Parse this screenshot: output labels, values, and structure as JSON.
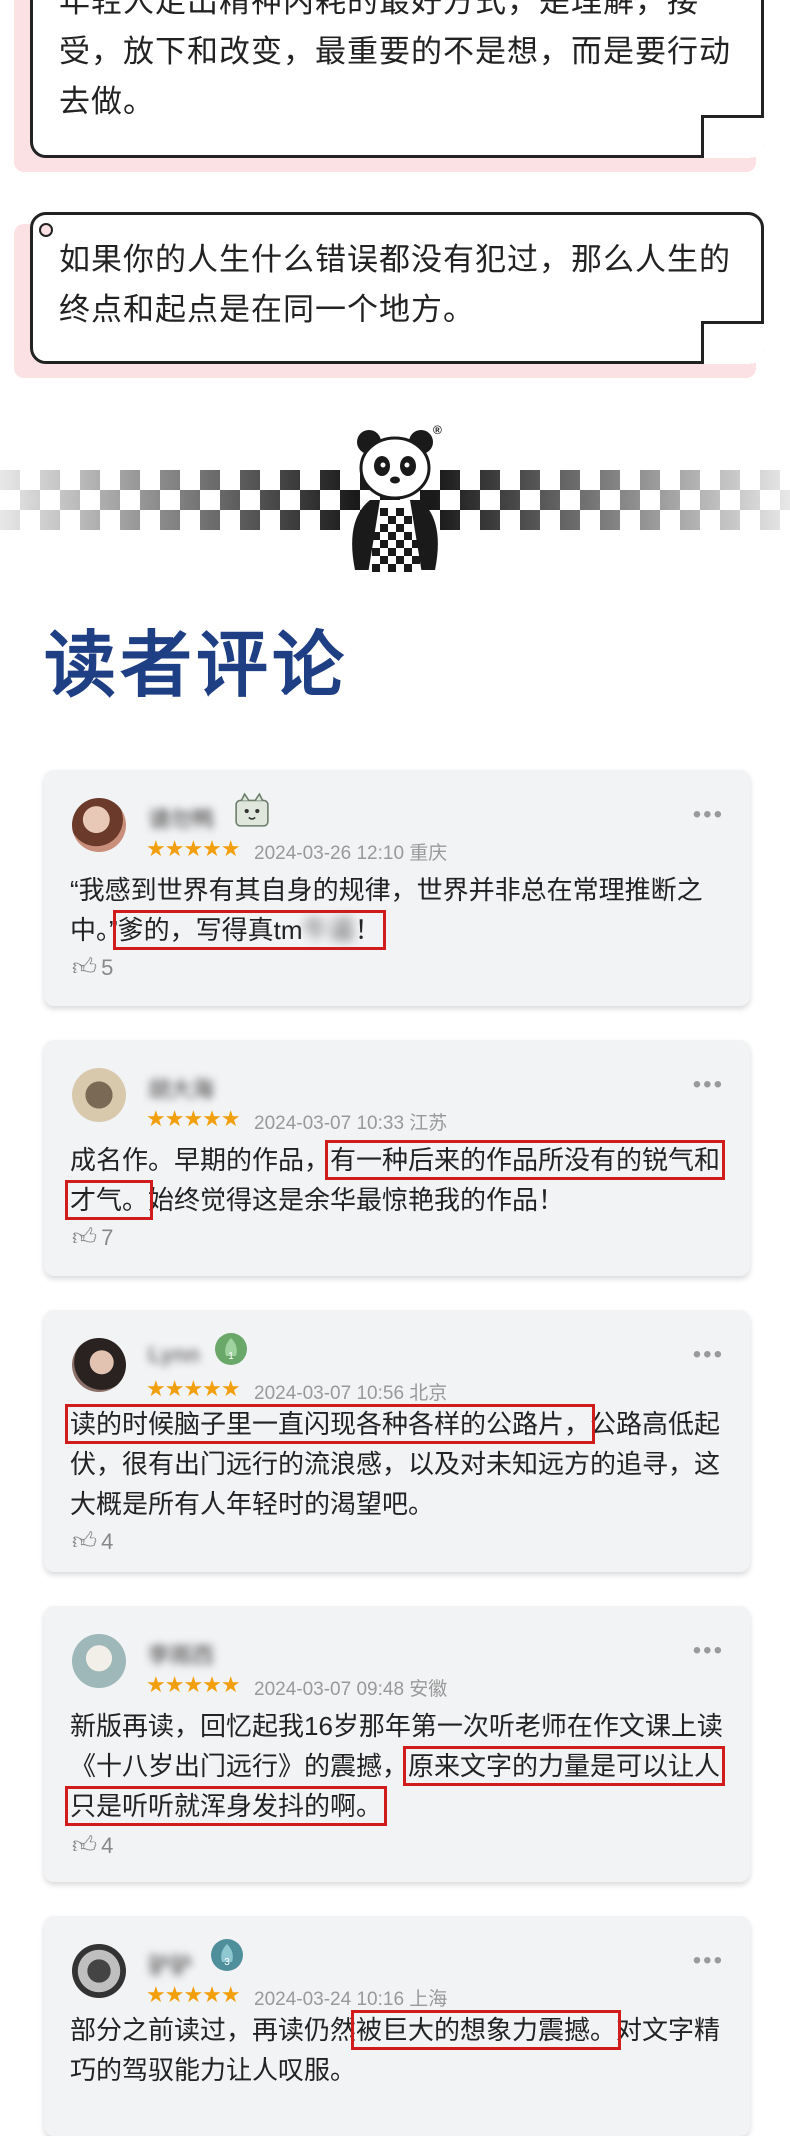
{
  "quotes": [
    {
      "text": "年轻人走出精神内耗的最好方式，是理解，接受，放下和改变，最重要的不是想，而是要行动去做。"
    },
    {
      "text": "如果你的人生什么错误都没有犯过，那么人生的终点和起点是在同一个地方。"
    }
  ],
  "divider": {
    "trademark": "®"
  },
  "section_title": "读者评论",
  "reviews": [
    {
      "username": "请勿鸭",
      "stars": "★★★★★",
      "datetime": "2024-03-26 12:10",
      "location": "重庆",
      "content_parts": [
        "“我感到世界有其自身的规律，世界并非总在常理推断之中。”",
        "爹的，写得真tm",
        "牛逼",
        "！"
      ],
      "likes": "5"
    },
    {
      "username": "胡大海",
      "stars": "★★★★★",
      "datetime": "2024-03-07 10:33",
      "location": "江苏",
      "content_parts": [
        "成名作。早期的作品，",
        "有一种后来的作品所没有的锐气和才气。",
        "始终觉得这是余华最惊艳我的作品！"
      ],
      "likes": "7"
    },
    {
      "username": "Lynn",
      "stars": "★★★★★",
      "datetime": "2024-03-07 10:56",
      "location": "北京",
      "content_parts": [
        "读的时候脑子里一直闪现各种各样的公路片，",
        "公路高低起伏，很有出门远行的流浪感，以及对未知远方的追寻，这大概是所有人年轻时的渴望吧。"
      ],
      "likes": "4"
    },
    {
      "username": "李雨西",
      "stars": "★★★★★",
      "datetime": "2024-03-07 09:48",
      "location": "安徽",
      "content_parts": [
        "新版再读，回忆起我16岁那年第一次听老师在作文课上读《十八岁出门远行》的震撼，",
        "原来文字的力量是可以让人只是听听就浑身发抖的啊。"
      ],
      "likes": "4"
    },
    {
      "username": "驴驴",
      "stars": "★★★★★",
      "datetime": "2024-03-24 10:16",
      "location": "上海",
      "content_parts": [
        "部分之前读过，再读仍然",
        "被巨大的想象力震撼。",
        "对文字精巧的驾驭能力让人叹服。"
      ],
      "likes": ""
    }
  ],
  "colors": {
    "title": "#1f3f84",
    "highlight": "#d11c1c",
    "stars": "#f29f0c"
  }
}
